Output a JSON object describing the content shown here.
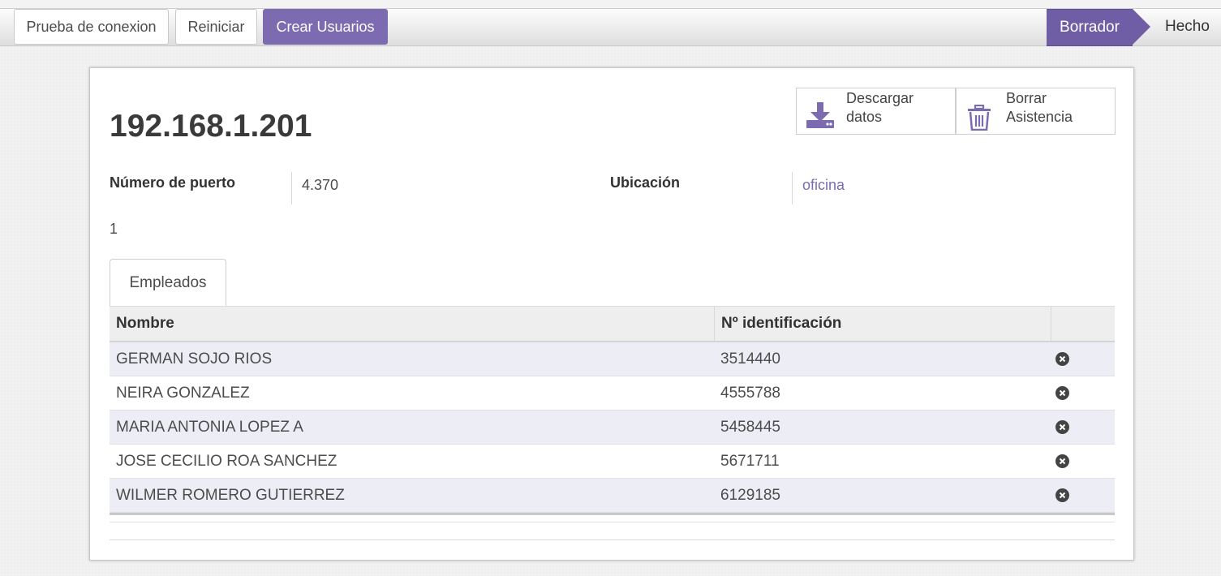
{
  "header": {
    "buttons": {
      "test_connection": "Prueba de conexion",
      "restart": "Reiniciar",
      "create_users": "Crear Usuarios"
    },
    "stages": {
      "draft": "Borrador",
      "done": "Hecho",
      "active_stage": "Borrador"
    }
  },
  "record": {
    "title": "192.168.1.201",
    "actions": {
      "download_line1": "Descargar",
      "download_line2": "datos",
      "clear_line1": "Borrar",
      "clear_line2": "Asistencia"
    },
    "fields": {
      "port_label": "Número de puerto",
      "port_value": "4.370",
      "location_label": "Ubicación",
      "location_value": "oficina",
      "extra_value": "1"
    }
  },
  "tabs": {
    "employees": "Empleados"
  },
  "table": {
    "headers": {
      "name": "Nombre",
      "id": "Nº identificación"
    },
    "rows": [
      {
        "name": "GERMAN SOJO RIOS",
        "id": "3514440"
      },
      {
        "name": "NEIRA GONZALEZ",
        "id": "4555788"
      },
      {
        "name": "MARIA ANTONIA LOPEZ A",
        "id": "5458445"
      },
      {
        "name": "JOSE CECILIO ROA SANCHEZ",
        "id": "5671711"
      },
      {
        "name": "WILMER ROMERO GUTIERREZ",
        "id": "6129185"
      }
    ]
  },
  "colors": {
    "primary": "#7c6bb0",
    "stage_active": "#6f5ea6",
    "row_stripe": "#ededf6",
    "link": "#7c6bb0"
  },
  "icons": {
    "download": "download-icon",
    "trash": "trash-icon",
    "remove_row": "circle-x-icon"
  }
}
